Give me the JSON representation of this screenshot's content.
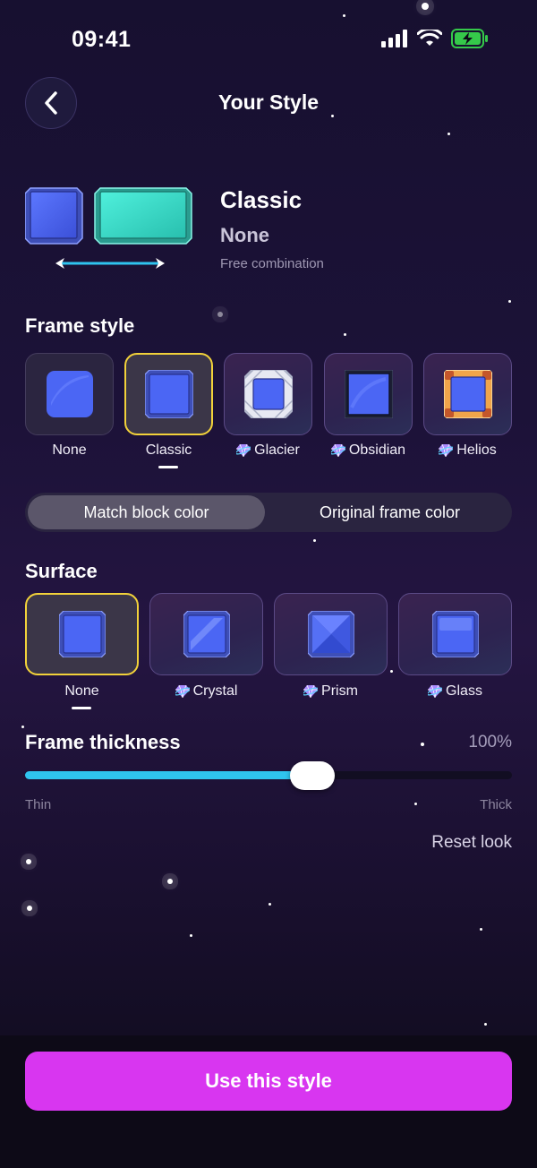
{
  "status": {
    "time": "09:41"
  },
  "header": {
    "title": "Your Style"
  },
  "preview": {
    "style_name": "Classic",
    "surface_name": "None",
    "note": "Free combination"
  },
  "frame_style": {
    "title": "Frame style",
    "options": [
      {
        "label": "None",
        "premium": false,
        "selected": false
      },
      {
        "label": "Classic",
        "premium": false,
        "selected": true
      },
      {
        "label": "Glacier",
        "premium": true,
        "selected": false
      },
      {
        "label": "Obsidian",
        "premium": true,
        "selected": false
      },
      {
        "label": "Helios",
        "premium": true,
        "selected": false
      }
    ]
  },
  "color_mode": {
    "options": [
      "Match block color",
      "Original frame color"
    ],
    "active": "Match block color"
  },
  "surface": {
    "title": "Surface",
    "options": [
      {
        "label": "None",
        "premium": false,
        "selected": true
      },
      {
        "label": "Crystal",
        "premium": true,
        "selected": false
      },
      {
        "label": "Prism",
        "premium": true,
        "selected": false
      },
      {
        "label": "Glass",
        "premium": true,
        "selected": false
      }
    ]
  },
  "thickness": {
    "label": "Frame thickness",
    "value_text": "100%",
    "level": 0.59,
    "min_label": "Thin",
    "max_label": "Thick"
  },
  "reset_label": "Reset look",
  "cta_label": "Use this style",
  "colors": {
    "accent_cta": "#d836f0",
    "selected_border": "#f2d23a",
    "slider_fill": "#2fc4ef",
    "block_blue": "#4a64f0",
    "preview_teal": "#36d6c6"
  }
}
